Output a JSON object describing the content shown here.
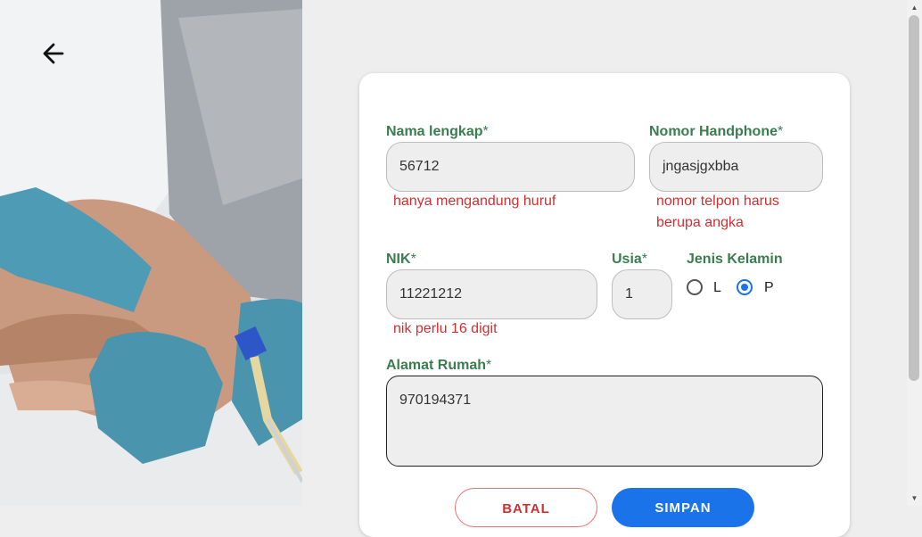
{
  "form": {
    "name": {
      "label": "Nama lengkap",
      "required_mark": "*",
      "value": "56712",
      "error": "hanya mengandung huruf"
    },
    "phone": {
      "label": "Nomor Handphone",
      "required_mark": "*",
      "value": "jngasjgxbba",
      "error_line1": "nomor telpon harus",
      "error_line2": "berupa angka"
    },
    "nik": {
      "label": "NIK",
      "required_mark": "*",
      "value": "11221212",
      "error": "nik perlu 16 digit"
    },
    "age": {
      "label": "Usia",
      "required_mark": "*",
      "value": "1"
    },
    "gender": {
      "label": "Jenis Kelamin",
      "options": [
        "L",
        "P"
      ],
      "selected": "P"
    },
    "address": {
      "label": "Alamat Rumah",
      "required_mark": "*",
      "value": "970194371"
    },
    "buttons": {
      "cancel": "BATAL",
      "save": "SIMPAN"
    }
  },
  "icons": {
    "back": "arrow-left-icon"
  },
  "colors": {
    "label": "#3a7d4e",
    "error": "#d32f2f",
    "primary": "#1a73e8"
  }
}
